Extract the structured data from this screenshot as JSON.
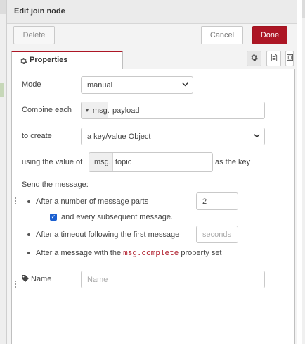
{
  "tray": {
    "title": "Edit join node",
    "delete_label": "Delete",
    "cancel_label": "Cancel",
    "done_label": "Done"
  },
  "tabs": {
    "properties_label": "Properties",
    "properties_icon": "gear-icon",
    "side_buttons": [
      "gear-icon",
      "description-icon",
      "appearance-icon"
    ]
  },
  "form": {
    "mode_label": "Mode",
    "mode_value": "manual",
    "combine_label": "Combine each",
    "combine_type": "msg.",
    "combine_value": "payload",
    "create_label": "to create",
    "create_value": "a key/value Object",
    "using_label": "using the value of",
    "using_type": "msg.",
    "using_value": "topic",
    "as_key_label": "as the key",
    "send_label": "Send the message:",
    "after_parts_label": "After a number of message parts",
    "parts_value": "2",
    "subsequent_label": "and every subsequent message.",
    "subsequent_checked": true,
    "timeout_label": "After a timeout following the first message",
    "timeout_placeholder": "seconds",
    "complete_prefix": "After a message with the",
    "complete_code": "msg.complete",
    "complete_suffix": "property set",
    "name_label": "Name",
    "name_placeholder": "Name"
  },
  "colors": {
    "accent": "#ad1625",
    "checkbox": "#1a5fd0"
  }
}
